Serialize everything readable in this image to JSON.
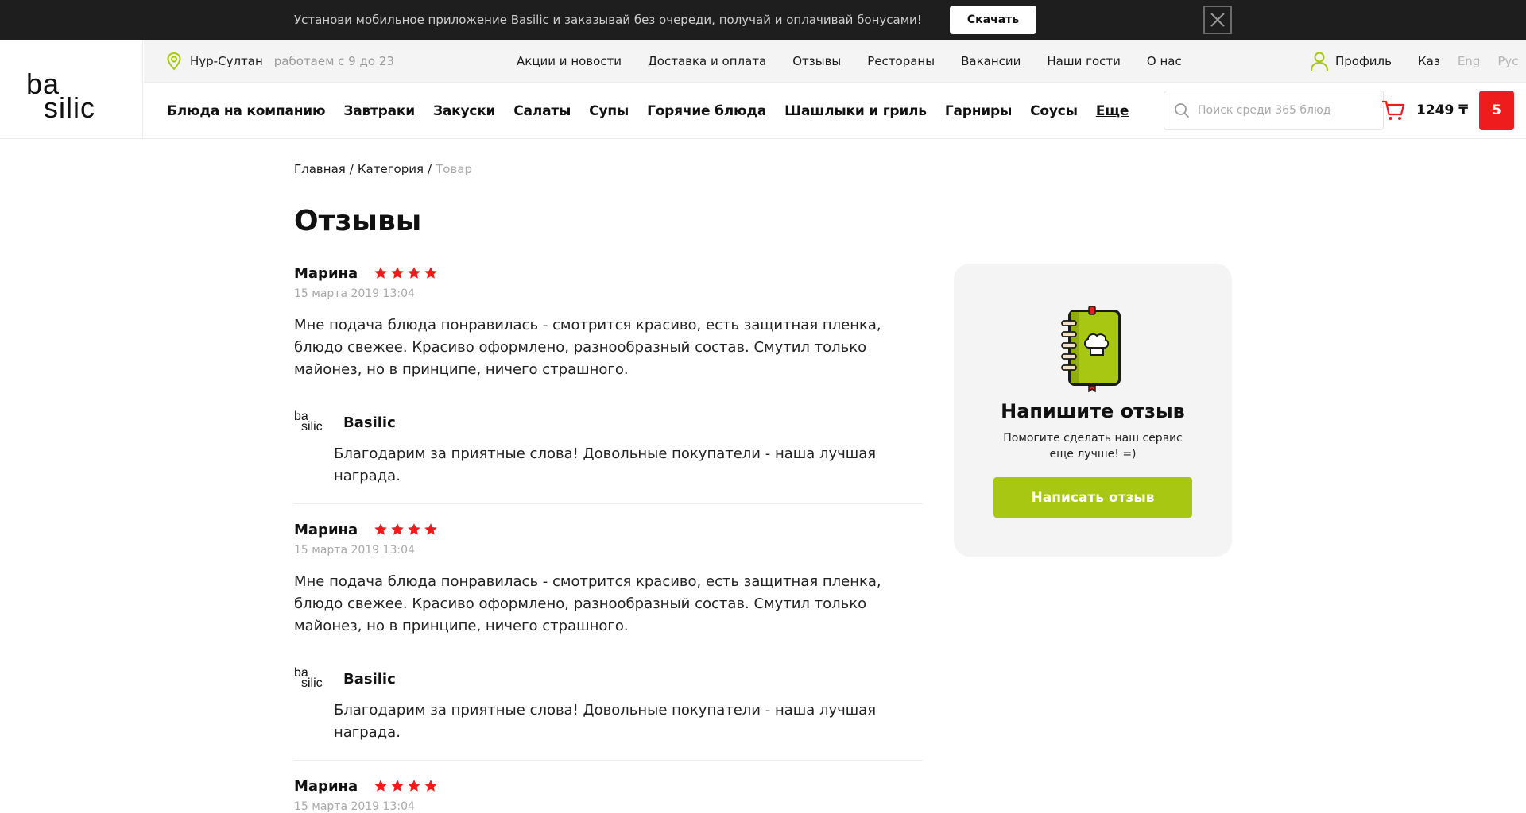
{
  "promo": {
    "text": "Установи мобильное приложение Basilic и заказывай без очереди, получай и оплачивай бонусами!",
    "download_label": "Скачать"
  },
  "header": {
    "logo_top": "ba",
    "logo_bottom": "silic",
    "city": "Нур-Султан",
    "hours": "работаем с 9 до 23",
    "top_nav": [
      "Акции и новости",
      "Доставка и оплата",
      "Отзывы",
      "Рестораны",
      "Вакансии",
      "Наши гости",
      "О нас"
    ],
    "profile_label": "Профиль",
    "languages": [
      "Каз",
      "Eng",
      "Рус"
    ],
    "main_nav": [
      "Блюда на компанию",
      "Завтраки",
      "Закуски",
      "Салаты",
      "Супы",
      "Горячие блюда",
      "Шашлыки и гриль",
      "Гарниры",
      "Соусы",
      "Еще"
    ],
    "search_placeholder": "Поиск среди 365 блюд",
    "cart_total": "1249 ₸",
    "cart_count": "5"
  },
  "breadcrumb": {
    "home": "Главная",
    "category": "Категория",
    "current": "Товар",
    "separator": "/"
  },
  "page_title": "Отзывы",
  "reviews": [
    {
      "author": "Марина",
      "rating": 4,
      "date": "15 марта 2019 13:04",
      "text": "Мне подача блюда понравилась - смотрится красиво, есть защитная пленка, блюдо свежее. Красиво оформлено, разнообразный состав. Смутил только майонез, но в принципе, ничего страшного.",
      "reply_author": "Basilic",
      "reply_text": "Благодарим за приятные слова! Довольные покупатели - наша лучшая награда."
    },
    {
      "author": "Марина",
      "rating": 4,
      "date": "15 марта 2019 13:04",
      "text": "Мне подача блюда понравилась - смотрится красиво, есть защитная пленка, блюдо свежее. Красиво оформлено, разнообразный состав. Смутил только майонез, но в принципе, ничего страшного.",
      "reply_author": "Basilic",
      "reply_text": "Благодарим за приятные слова! Довольные покупатели - наша лучшая награда."
    },
    {
      "author": "Марина",
      "rating": 4,
      "date": "15 марта 2019 13:04"
    }
  ],
  "review_card": {
    "title": "Напишите отзыв",
    "subtitle": "Помогите сделать наш сервис еще лучше! =)",
    "button_label": "Написать отзыв"
  },
  "colors": {
    "accent_green": "#a8c712",
    "star_red": "#ee1c1c",
    "promo_bg": "#1e1e1e"
  }
}
